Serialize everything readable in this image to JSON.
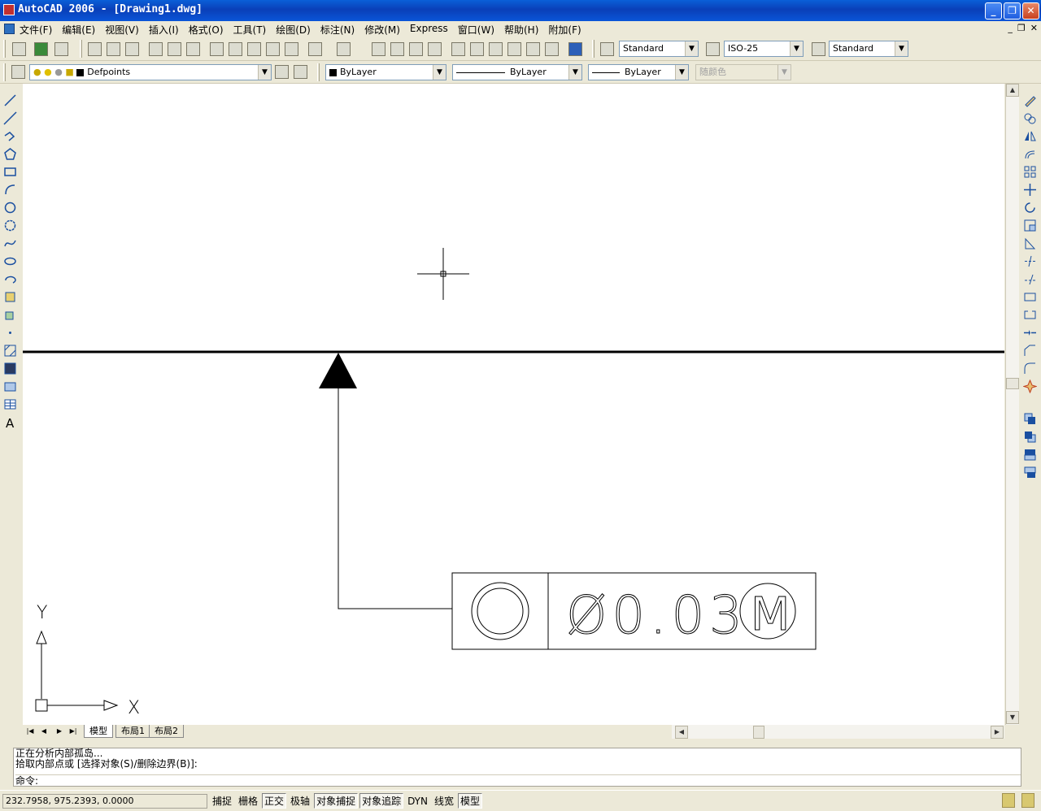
{
  "window": {
    "title": "AutoCAD 2006 - [Drawing1.dwg]"
  },
  "menus": [
    "文件(F)",
    "编辑(E)",
    "视图(V)",
    "插入(I)",
    "格式(O)",
    "工具(T)",
    "绘图(D)",
    "标注(N)",
    "修改(M)",
    "Express",
    "窗口(W)",
    "帮助(H)",
    "附加(F)"
  ],
  "styles": {
    "text_style": "Standard",
    "dim_style": "ISO-25",
    "table_style": "Standard"
  },
  "layers": {
    "current": "Defpoints"
  },
  "properties": {
    "color": "ByLayer",
    "linetype": "ByLayer",
    "lineweight": "ByLayer",
    "plot_style": "随颜色"
  },
  "drawing": {
    "ucs_x": "X",
    "ucs_y": "Y",
    "fcf_tolerance": "Ø0.03",
    "fcf_modifier": "M"
  },
  "tabs": [
    "模型",
    "布局1",
    "布局2"
  ],
  "command": {
    "history": [
      "正在分析内部孤岛...",
      "拾取内部点或 [选择对象(S)/删除边界(B)]:"
    ],
    "prompt": "命令:"
  },
  "status": {
    "coords": "232.7958, 975.2393, 0.0000",
    "buttons": [
      {
        "label": "捕捉",
        "on": false
      },
      {
        "label": "栅格",
        "on": false
      },
      {
        "label": "正交",
        "on": true
      },
      {
        "label": "极轴",
        "on": false
      },
      {
        "label": "对象捕捉",
        "on": true
      },
      {
        "label": "对象追踪",
        "on": true
      },
      {
        "label": "DYN",
        "on": false
      },
      {
        "label": "线宽",
        "on": false
      },
      {
        "label": "模型",
        "on": true
      }
    ]
  }
}
